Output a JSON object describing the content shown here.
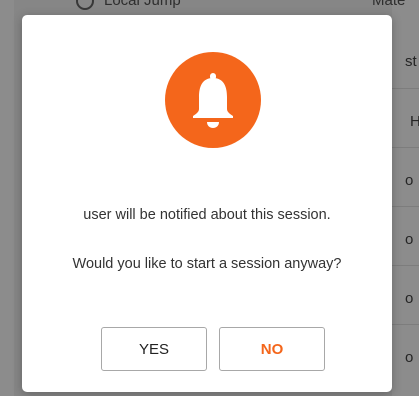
{
  "background": {
    "top_item_label": "Local Jump",
    "top_right_label": "Mate",
    "right_fragments": [
      "st",
      "H",
      "o",
      "o",
      "o",
      "o"
    ]
  },
  "dialog": {
    "icon": "bell-icon",
    "accent_color": "#f4661b",
    "message_line1": "user will be notified about this session.",
    "message_line2": "Would you like to start a session anyway?",
    "yes_label": "YES",
    "no_label": "NO"
  }
}
